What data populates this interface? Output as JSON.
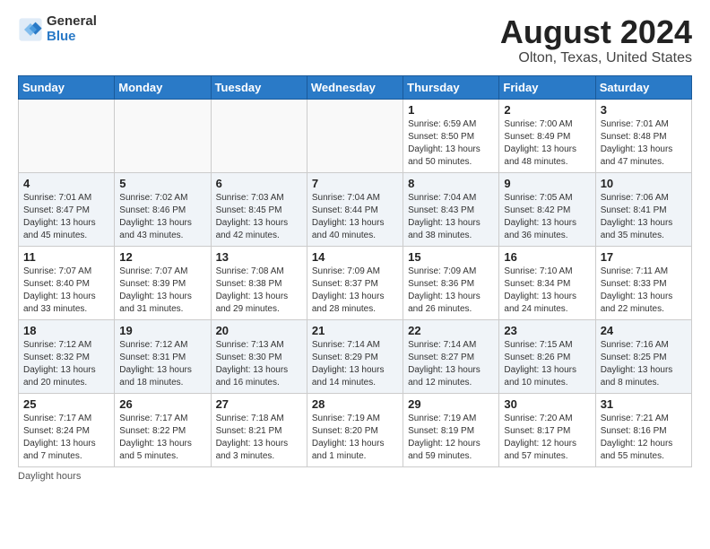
{
  "logo": {
    "line1": "General",
    "line2": "Blue"
  },
  "title": "August 2024",
  "location": "Olton, Texas, United States",
  "days_of_week": [
    "Sunday",
    "Monday",
    "Tuesday",
    "Wednesday",
    "Thursday",
    "Friday",
    "Saturday"
  ],
  "footer": "Daylight hours",
  "weeks": [
    [
      {
        "num": "",
        "info": ""
      },
      {
        "num": "",
        "info": ""
      },
      {
        "num": "",
        "info": ""
      },
      {
        "num": "",
        "info": ""
      },
      {
        "num": "1",
        "info": "Sunrise: 6:59 AM\nSunset: 8:50 PM\nDaylight: 13 hours and 50 minutes."
      },
      {
        "num": "2",
        "info": "Sunrise: 7:00 AM\nSunset: 8:49 PM\nDaylight: 13 hours and 48 minutes."
      },
      {
        "num": "3",
        "info": "Sunrise: 7:01 AM\nSunset: 8:48 PM\nDaylight: 13 hours and 47 minutes."
      }
    ],
    [
      {
        "num": "4",
        "info": "Sunrise: 7:01 AM\nSunset: 8:47 PM\nDaylight: 13 hours and 45 minutes."
      },
      {
        "num": "5",
        "info": "Sunrise: 7:02 AM\nSunset: 8:46 PM\nDaylight: 13 hours and 43 minutes."
      },
      {
        "num": "6",
        "info": "Sunrise: 7:03 AM\nSunset: 8:45 PM\nDaylight: 13 hours and 42 minutes."
      },
      {
        "num": "7",
        "info": "Sunrise: 7:04 AM\nSunset: 8:44 PM\nDaylight: 13 hours and 40 minutes."
      },
      {
        "num": "8",
        "info": "Sunrise: 7:04 AM\nSunset: 8:43 PM\nDaylight: 13 hours and 38 minutes."
      },
      {
        "num": "9",
        "info": "Sunrise: 7:05 AM\nSunset: 8:42 PM\nDaylight: 13 hours and 36 minutes."
      },
      {
        "num": "10",
        "info": "Sunrise: 7:06 AM\nSunset: 8:41 PM\nDaylight: 13 hours and 35 minutes."
      }
    ],
    [
      {
        "num": "11",
        "info": "Sunrise: 7:07 AM\nSunset: 8:40 PM\nDaylight: 13 hours and 33 minutes."
      },
      {
        "num": "12",
        "info": "Sunrise: 7:07 AM\nSunset: 8:39 PM\nDaylight: 13 hours and 31 minutes."
      },
      {
        "num": "13",
        "info": "Sunrise: 7:08 AM\nSunset: 8:38 PM\nDaylight: 13 hours and 29 minutes."
      },
      {
        "num": "14",
        "info": "Sunrise: 7:09 AM\nSunset: 8:37 PM\nDaylight: 13 hours and 28 minutes."
      },
      {
        "num": "15",
        "info": "Sunrise: 7:09 AM\nSunset: 8:36 PM\nDaylight: 13 hours and 26 minutes."
      },
      {
        "num": "16",
        "info": "Sunrise: 7:10 AM\nSunset: 8:34 PM\nDaylight: 13 hours and 24 minutes."
      },
      {
        "num": "17",
        "info": "Sunrise: 7:11 AM\nSunset: 8:33 PM\nDaylight: 13 hours and 22 minutes."
      }
    ],
    [
      {
        "num": "18",
        "info": "Sunrise: 7:12 AM\nSunset: 8:32 PM\nDaylight: 13 hours and 20 minutes."
      },
      {
        "num": "19",
        "info": "Sunrise: 7:12 AM\nSunset: 8:31 PM\nDaylight: 13 hours and 18 minutes."
      },
      {
        "num": "20",
        "info": "Sunrise: 7:13 AM\nSunset: 8:30 PM\nDaylight: 13 hours and 16 minutes."
      },
      {
        "num": "21",
        "info": "Sunrise: 7:14 AM\nSunset: 8:29 PM\nDaylight: 13 hours and 14 minutes."
      },
      {
        "num": "22",
        "info": "Sunrise: 7:14 AM\nSunset: 8:27 PM\nDaylight: 13 hours and 12 minutes."
      },
      {
        "num": "23",
        "info": "Sunrise: 7:15 AM\nSunset: 8:26 PM\nDaylight: 13 hours and 10 minutes."
      },
      {
        "num": "24",
        "info": "Sunrise: 7:16 AM\nSunset: 8:25 PM\nDaylight: 13 hours and 8 minutes."
      }
    ],
    [
      {
        "num": "25",
        "info": "Sunrise: 7:17 AM\nSunset: 8:24 PM\nDaylight: 13 hours and 7 minutes."
      },
      {
        "num": "26",
        "info": "Sunrise: 7:17 AM\nSunset: 8:22 PM\nDaylight: 13 hours and 5 minutes."
      },
      {
        "num": "27",
        "info": "Sunrise: 7:18 AM\nSunset: 8:21 PM\nDaylight: 13 hours and 3 minutes."
      },
      {
        "num": "28",
        "info": "Sunrise: 7:19 AM\nSunset: 8:20 PM\nDaylight: 13 hours and 1 minute."
      },
      {
        "num": "29",
        "info": "Sunrise: 7:19 AM\nSunset: 8:19 PM\nDaylight: 12 hours and 59 minutes."
      },
      {
        "num": "30",
        "info": "Sunrise: 7:20 AM\nSunset: 8:17 PM\nDaylight: 12 hours and 57 minutes."
      },
      {
        "num": "31",
        "info": "Sunrise: 7:21 AM\nSunset: 8:16 PM\nDaylight: 12 hours and 55 minutes."
      }
    ]
  ]
}
